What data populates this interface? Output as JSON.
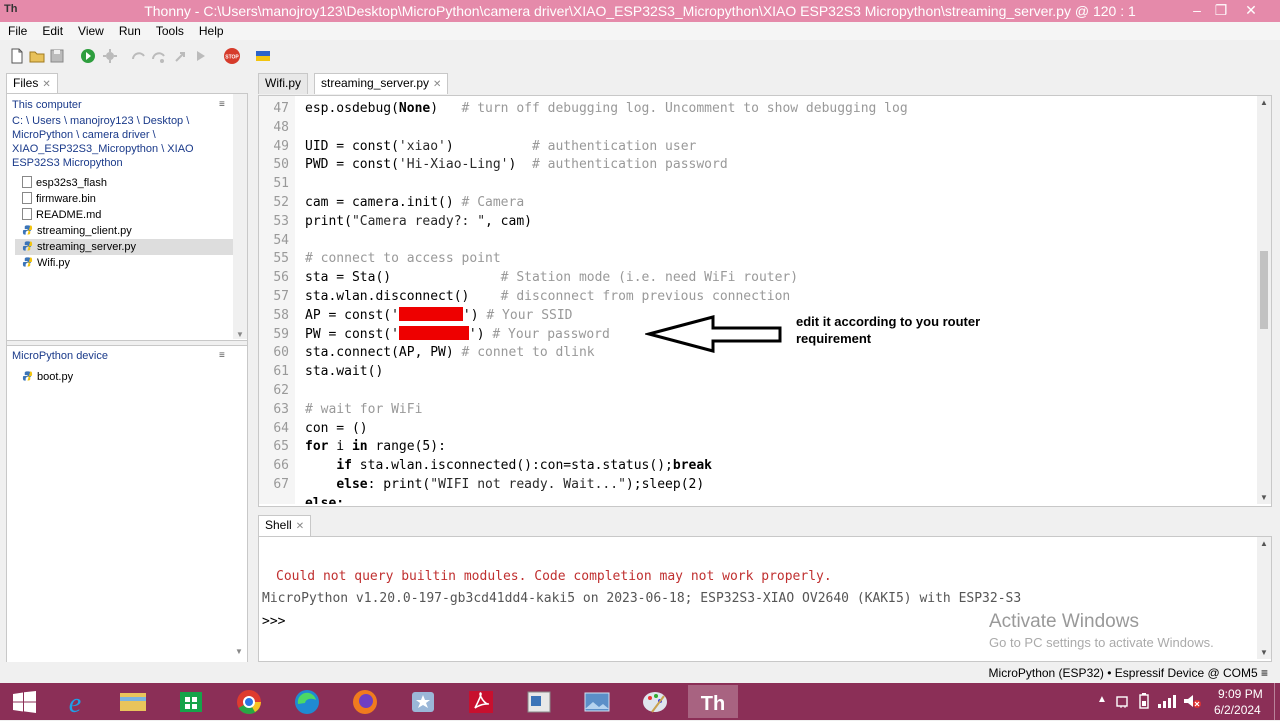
{
  "window": {
    "title": "Thonny  -  C:\\Users\\manojroy123\\Desktop\\MicroPython\\camera driver\\XIAO_ESP32S3_Micropython\\XIAO ESP32S3 Micropython\\streaming_server.py  @  120 : 1",
    "app_icon": "Th",
    "controls": [
      "–",
      "❐",
      "✕"
    ]
  },
  "menu": [
    "File",
    "Edit",
    "View",
    "Run",
    "Tools",
    "Help"
  ],
  "toolbar": {
    "icons": [
      "new-file-icon",
      "open-folder-icon",
      "save-icon",
      "run-icon",
      "debug-icon",
      "step-over-icon",
      "step-into-icon",
      "step-out-icon",
      "resume-icon",
      "stop-icon",
      "ukraine-flag-icon"
    ],
    "stop_label": "STOP"
  },
  "files_panel": {
    "tab": "Files",
    "this_computer": {
      "header": "This computer",
      "path_lines": [
        "C: \\ Users \\ manojroy123 \\ Desktop \\",
        "MicroPython \\ camera driver \\",
        "XIAO_ESP32S3_Micropython \\ XIAO",
        "ESP32S3 Micropython"
      ],
      "items": [
        {
          "name": "esp32s3_flash",
          "icon": "file-icon",
          "selected": false
        },
        {
          "name": "firmware.bin",
          "icon": "file-icon",
          "selected": false
        },
        {
          "name": "README.md",
          "icon": "file-icon",
          "selected": false
        },
        {
          "name": "streaming_client.py",
          "icon": "python-file-icon",
          "selected": false
        },
        {
          "name": "streaming_server.py",
          "icon": "python-file-icon",
          "selected": true
        },
        {
          "name": "Wifi.py",
          "icon": "python-file-icon",
          "selected": false
        }
      ]
    },
    "device": {
      "header": "MicroPython device",
      "items": [
        {
          "name": "boot.py",
          "icon": "python-file-icon"
        }
      ]
    }
  },
  "editor": {
    "tabs": [
      {
        "label": "Wifi.py",
        "active": false
      },
      {
        "label": "streaming_server.py",
        "active": true
      }
    ],
    "line_numbers": [
      "47",
      "48",
      "49",
      "50",
      "51",
      "52",
      "53",
      "54",
      "55",
      "56",
      "57",
      "58",
      "59",
      "60",
      "61",
      "62",
      "63",
      "64",
      "65",
      "66",
      "67"
    ],
    "lines": {
      "l47_code": "esp.osdebug(",
      "l47_kw": "None",
      "l47_rest": ")   ",
      "l47_cm": "# turn off debugging log. Uncomment to show debugging log",
      "l49_code": "UID = const(",
      "l49_st": "'xiao'",
      "l49_rest": ")          ",
      "l49_cm": "# authentication user",
      "l50_code": "PWD = const(",
      "l50_st": "'Hi-Xiao-Ling'",
      "l50_rest": ")  ",
      "l50_cm": "# authentication password",
      "l52_code": "cam = camera.init() ",
      "l52_cm": "# Camera",
      "l53_code": "print(",
      "l53_st": "\"Camera ready?: \"",
      "l53_rest": ", cam)",
      "l55_cm": "# connect to access point",
      "l56_code": "sta = Sta()              ",
      "l56_cm": "# Station mode (i.e. need WiFi router)",
      "l57_code": "sta.wlan.disconnect()    ",
      "l57_cm": "# disconnect from previous connection",
      "l58_code": "AP = const(",
      "l58_q1": "'",
      "l58_q2": "'",
      "l58_rest": ") ",
      "l58_cm": "# Your SSID",
      "l59_code": "PW = const(",
      "l59_q1": "'",
      "l59_q2": "'",
      "l59_rest": ") ",
      "l59_cm": "# Your password",
      "l60_code": "sta.connect(AP, PW) ",
      "l60_cm": "# connet to dlink",
      "l61_code": "sta.wait()",
      "l63_cm": "# wait for WiFi",
      "l64_code": "con = ()",
      "l65_kw1": "for",
      "l65_mid": " i ",
      "l65_kw2": "in",
      "l65_rest": " range(5):",
      "l66_indent": "    ",
      "l66_kw1": "if",
      "l66_mid": " sta.wlan.isconnected():con=sta.status();",
      "l66_kw2": "break",
      "l67_indent": "    ",
      "l67_kw": "else",
      "l67_mid": ": print(",
      "l67_st": "\"WIFI not ready. Wait...\"",
      "l67_rest": ");sleep(2)",
      "l68_partial": "else:"
    }
  },
  "annotation": {
    "text": "edit it according to you router requirement"
  },
  "shell": {
    "tab": "Shell",
    "warning": "Could not query builtin modules. Code completion may not work properly.",
    "version": "MicroPython v1.20.0-197-gb3cd41dd4-kaki5 on 2023-06-18; ESP32S3-XIAO OV2640 (KAKI5) with ESP32-S3",
    "prompt": ">>>"
  },
  "watermark": {
    "title": "Activate Windows",
    "subtitle": "Go to PC settings to activate Windows."
  },
  "statusbar": {
    "text": "MicroPython (ESP32)  •  Espressif Device @ COM5  ≡"
  },
  "taskbar": {
    "apps": [
      "start-icon",
      "internet-explorer-icon",
      "file-explorer-icon",
      "store-icon",
      "chrome-icon",
      "edge-icon",
      "firefox-icon",
      "app-star-icon",
      "acrobat-icon",
      "document-icon",
      "photos-icon",
      "paint-icon",
      "thonny-icon"
    ],
    "thonny_label": "Th",
    "time": "9:09 PM",
    "date": "6/2/2024"
  },
  "colors": {
    "titlebar": "#e58aaa",
    "taskbar": "#8b2f57",
    "redaction": "#e00000",
    "shell_warning": "#c03030"
  }
}
